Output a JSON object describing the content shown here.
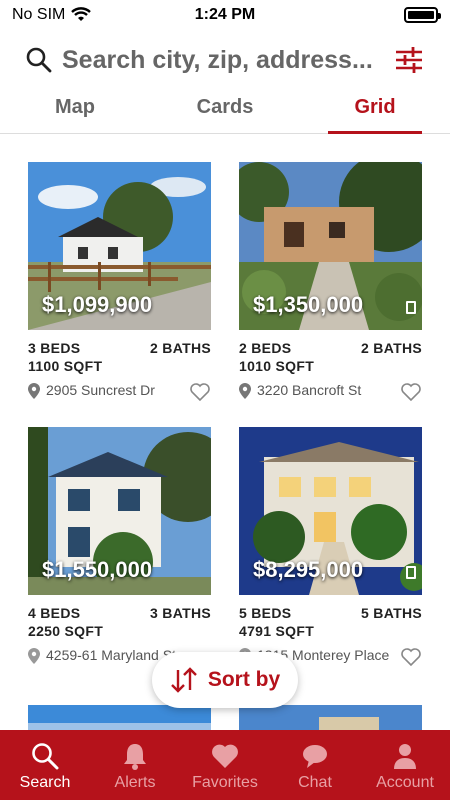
{
  "status": {
    "carrier": "No SIM",
    "time": "1:24 PM"
  },
  "search": {
    "placeholder": "Search city, zip, address..."
  },
  "tabs": [
    {
      "label": "Map"
    },
    {
      "label": "Cards"
    },
    {
      "label": "Grid",
      "active": true
    }
  ],
  "listings": [
    {
      "price": "$1,099,900",
      "beds": "3 BEDS",
      "baths": "2 BATHS",
      "sqft": "1100 SQFT",
      "address": "2905 Suncrest Dr"
    },
    {
      "price": "$1,350,000",
      "beds": "2 BEDS",
      "baths": "2 BATHS",
      "sqft": "1010 SQFT",
      "address": "3220 Bancroft St"
    },
    {
      "price": "$1,550,000",
      "beds": "4 BEDS",
      "baths": "3 BATHS",
      "sqft": "2250 SQFT",
      "address": "4259-61 Maryland St"
    },
    {
      "price": "$8,295,000",
      "beds": "5 BEDS",
      "baths": "5 BATHS",
      "sqft": "4791 SQFT",
      "address": "1315 Monterey Place"
    }
  ],
  "sort": {
    "label": "Sort by"
  },
  "tabbar": [
    {
      "label": "Search",
      "icon": "search-icon",
      "active": true
    },
    {
      "label": "Alerts",
      "icon": "bell-icon"
    },
    {
      "label": "Favorites",
      "icon": "heart-icon"
    },
    {
      "label": "Chat",
      "icon": "chat-bubble-icon"
    },
    {
      "label": "Account",
      "icon": "person-icon"
    }
  ],
  "colors": {
    "accent": "#b5121b",
    "tabbar_inactive": "#e8a0a4"
  }
}
